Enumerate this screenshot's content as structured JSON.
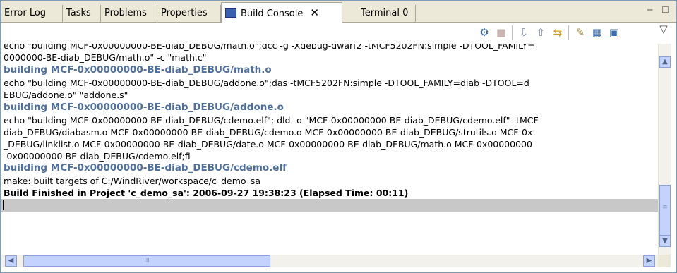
{
  "tabs": [
    {
      "label": "Error Log"
    },
    {
      "label": "Tasks"
    },
    {
      "label": "Problems"
    },
    {
      "label": "Properties"
    },
    {
      "label": "Build Console",
      "active": true,
      "close": "✕"
    },
    {
      "label": "Terminal 0"
    }
  ],
  "window_controls": {
    "minimize": "─",
    "maximize": "☐"
  },
  "toolbar_icons": [
    "console-connect-icon",
    "stop-icon",
    "next-error-icon",
    "previous-error-icon",
    "link-icon",
    "clear-console-icon",
    "scroll-lock-icon",
    "save-icon",
    "view-menu-icon"
  ],
  "console_lines": [
    {
      "text": "echo \"building MCF-0x00000000-BE-diab_DEBUG/math.o\";dcc -g -Xdebug-dwarf2 -tMCF5202FN:simple -DTOOL_FAMILY=",
      "style": "normal"
    },
    {
      "text": "0000000-BE-diab_DEBUG/math.o\" -c \"math.c\"",
      "style": "normal"
    },
    {
      "text": "building MCF-0x00000000-BE-diab_DEBUG/math.o",
      "style": "link"
    },
    {
      "text": "echo \"building MCF-0x00000000-BE-diab_DEBUG/addone.o\";das -tMCF5202FN:simple -DTOOL_FAMILY=diab -DTOOL=d",
      "style": "normal"
    },
    {
      "text": "EBUG/addone.o\" \"addone.s\"",
      "style": "normal"
    },
    {
      "text": "building MCF-0x00000000-BE-diab_DEBUG/addone.o",
      "style": "link"
    },
    {
      "text": "echo \"building MCF-0x00000000-BE-diab_DEBUG/cdemo.elf\"; dld -o \"MCF-0x00000000-BE-diab_DEBUG/cdemo.elf\" -tMCF",
      "style": "normal"
    },
    {
      "text": "diab_DEBUG/diabasm.o MCF-0x00000000-BE-diab_DEBUG/cdemo.o MCF-0x00000000-BE-diab_DEBUG/strutils.o MCF-0x",
      "style": "normal"
    },
    {
      "text": "_DEBUG/linklist.o MCF-0x00000000-BE-diab_DEBUG/date.o MCF-0x00000000-BE-diab_DEBUG/math.o MCF-0x00000000",
      "style": "normal"
    },
    {
      "text": "-0x00000000-BE-diab_DEBUG/cdemo.elf;fi",
      "style": "normal"
    },
    {
      "text": "building MCF-0x00000000-BE-diab_DEBUG/cdemo.elf",
      "style": "link"
    },
    {
      "text": "make: built targets of C:/WindRiver/workspace/c_demo_sa",
      "style": "normal"
    },
    {
      "text": "Build Finished in Project 'c_demo_sa':   2006-09-27 19:38:23   (Elapsed Time: 00:11)",
      "style": "bold"
    }
  ],
  "scroll": {
    "up": "▲",
    "down": "▼",
    "left": "◀",
    "right": "▶",
    "grip": "≡",
    "hgrip": "III"
  }
}
